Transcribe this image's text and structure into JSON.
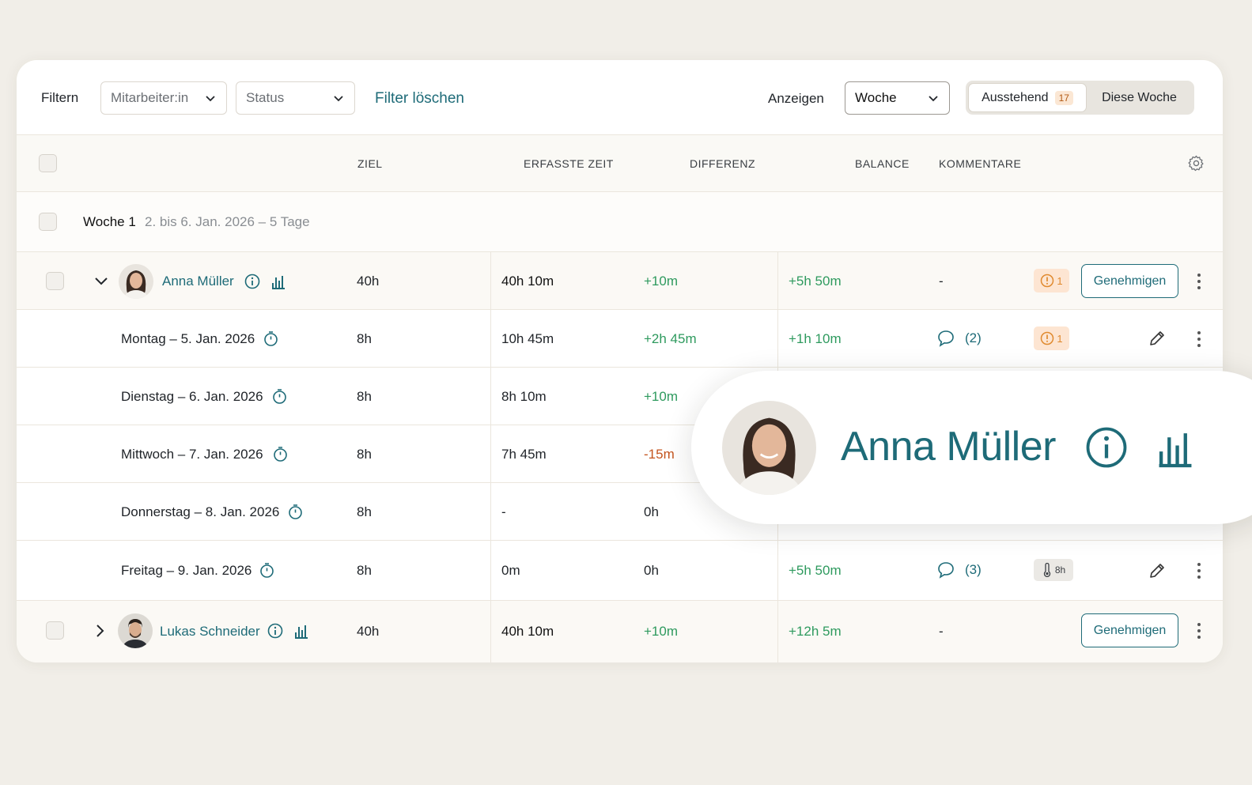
{
  "toolbar": {
    "filter_label": "Filtern",
    "employee_placeholder": "Mitarbeiter:in",
    "status_placeholder": "Status",
    "clear_filter": "Filter löschen",
    "show_label": "Anzeigen",
    "period_value": "Woche",
    "pending_label": "Ausstehend",
    "pending_count": "17",
    "this_week_label": "Diese Woche"
  },
  "table": {
    "headers": [
      "ZIEL",
      "ERFASSTE ZEIT",
      "DIFFERENZ",
      "BALANCE",
      "KOMMENTARE"
    ],
    "week": {
      "title": "Woche 1",
      "range": "2. bis 6. Jan. 2026 – 5 Tage"
    },
    "employees": [
      {
        "name": "Anna Müller",
        "target": "40h",
        "tracked": "40h 10m",
        "diff": "+10m",
        "balance": "+5h 50m",
        "comments": "-",
        "warning_count": "1",
        "approve_label": "Genehmigen",
        "expanded": true
      },
      {
        "name": "Lukas Schneider",
        "target": "40h",
        "tracked": "40h 10m",
        "diff": "+10m",
        "balance": "+12h 5m",
        "comments": "-",
        "approve_label": "Genehmigen",
        "expanded": false
      }
    ],
    "days": [
      {
        "label": "Montag – 5. Jan. 2026",
        "target": "8h",
        "tracked": "10h 45m",
        "diff": "+2h 45m",
        "balance": "+1h 10m",
        "comments": "(2)",
        "warning_count": "1"
      },
      {
        "label": "Dienstag – 6. Jan. 2026",
        "target": "8h",
        "tracked": "8h 10m",
        "diff": "+10m"
      },
      {
        "label": "Mittwoch – 7. Jan. 2026",
        "target": "8h",
        "tracked": "7h 45m",
        "diff": "-15m"
      },
      {
        "label": "Donnerstag – 8. Jan. 2026",
        "target": "8h",
        "tracked": "-",
        "diff": "0h"
      },
      {
        "label": "Freitag – 9. Jan. 2026",
        "target": "8h",
        "tracked": "0m",
        "diff": "0h",
        "balance": "+5h 50m",
        "comments": "(3)",
        "holiday_hours": "8h"
      }
    ]
  },
  "popover": {
    "name": "Anna Müller"
  },
  "colors": {
    "accent": "#1e6b78",
    "positive": "#2e9a5e",
    "negative": "#c4541e",
    "warning": "#e08a2f",
    "background": "#f1eee8"
  }
}
